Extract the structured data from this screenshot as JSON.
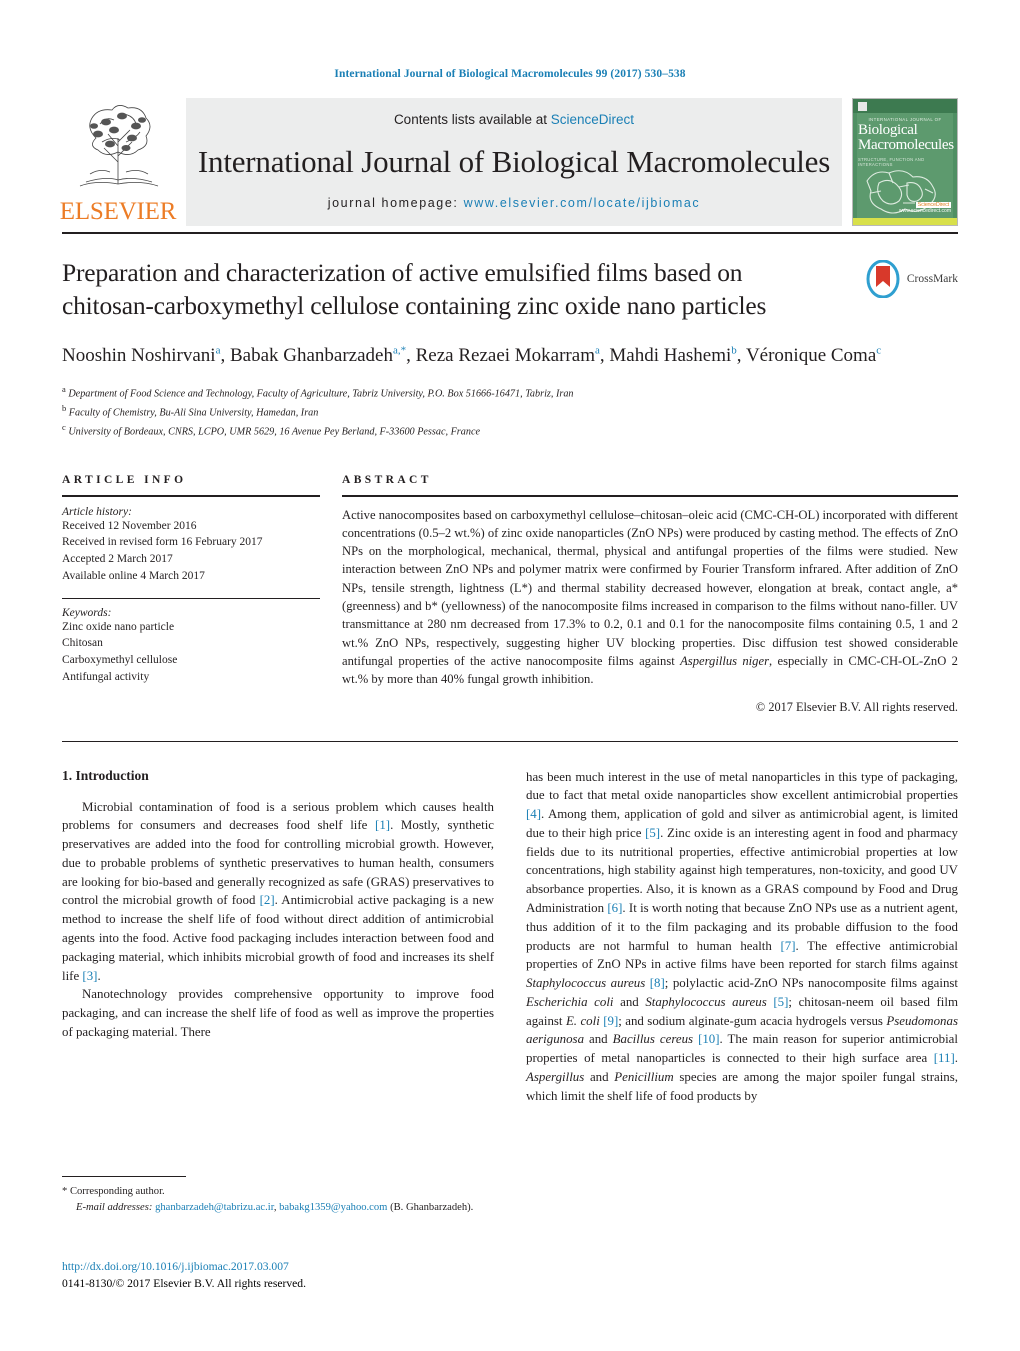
{
  "running_head": "International Journal of Biological Macromolecules 99 (2017) 530–538",
  "masthead": {
    "publisher": "ELSEVIER",
    "contents_prefix": "Contents lists available at ",
    "contents_link": "ScienceDirect",
    "journal_title": "International Journal of Biological Macromolecules",
    "homepage_prefix": "journal homepage: ",
    "homepage_url": "www.elsevier.com/locate/ijbiomac",
    "cover": {
      "kicker": "INTERNATIONAL JOURNAL OF",
      "line1": "Biological",
      "line2": "Macromolecules",
      "subtitle": "STRUCTURE, FUNCTION AND INTERACTIONS",
      "sciencedirect": "ScienceDirect",
      "sciencedirect_sub": "www.sciencedirect.com"
    }
  },
  "article": {
    "title": "Preparation and characterization of active emulsified films based on chitosan-carboxymethyl cellulose containing zinc oxide nano particles",
    "crossmark_label": "CrossMark",
    "authors_html": "Nooshin Noshirvani<sup>a</sup>, Babak Ghanbarzadeh<sup>a,*</sup>, Reza Rezaei Mokarram<sup>a</sup>, Mahdi Hashemi<sup>b</sup>, Véronique Coma<sup>c</sup>",
    "affiliations": [
      {
        "marker": "a",
        "text": "Department of Food Science and Technology, Faculty of Agriculture, Tabriz University, P.O. Box 51666-16471, Tabriz, Iran"
      },
      {
        "marker": "b",
        "text": "Faculty of Chemistry, Bu-Ali Sina University, Hamedan, Iran"
      },
      {
        "marker": "c",
        "text": "University of Bordeaux, CNRS, LCPO, UMR 5629, 16 Avenue Pey Berland, F-33600 Pessac, France"
      }
    ]
  },
  "article_info": {
    "label": "ARTICLE INFO",
    "history_heading": "Article history:",
    "history": [
      "Received 12 November 2016",
      "Received in revised form 16 February 2017",
      "Accepted 2 March 2017",
      "Available online 4 March 2017"
    ],
    "keywords_heading": "Keywords:",
    "keywords": [
      "Zinc oxide nano particle",
      "Chitosan",
      "Carboxymethyl cellulose",
      "Antifungal activity"
    ]
  },
  "abstract": {
    "label": "ABSTRACT",
    "text_html": "Active nanocomposites based on carboxymethyl cellulose–chitosan–oleic acid (CMC-CH-OL) incorporated with different concentrations (0.5–2 wt.%) of zinc oxide nanoparticles (ZnO NPs) were produced by casting method. The effects of ZnO NPs on the morphological, mechanical, thermal, physical and antifungal properties of the films were studied. New interaction between ZnO NPs and polymer matrix were confirmed by Fourier Transform infrared. After addition of ZnO NPs, tensile strength, lightness (L*) and thermal stability decreased however, elongation at break, contact angle, a* (greenness) and b* (yellowness) of the nanocomposite films increased in comparison to the films without nano-filler. UV transmittance at 280 nm decreased from 17.3% to 0.2, 0.1 and 0.1 for the nanocomposite films containing 0.5, 1 and 2 wt.% ZnO NPs, respectively, suggesting higher UV blocking properties. Disc diffusion test showed considerable antifungal properties of the active nanocomposite films against <i>Aspergillus niger</i>, especially in CMC-CH-OL-ZnO 2 wt.% by more than 40% fungal growth inhibition.",
    "copyright": "© 2017 Elsevier B.V. All rights reserved."
  },
  "body": {
    "section_heading": "1. Introduction",
    "left_paragraphs_html": [
      "Microbial contamination of food is a serious problem which causes health problems for consumers and decreases food shelf life <span class=\"ref\">[1]</span>. Mostly, synthetic preservatives are added into the food for controlling microbial growth. However, due to probable problems of synthetic preservatives to human health, consumers are looking for bio-based and generally recognized as safe (GRAS) preservatives to control the microbial growth of food <span class=\"ref\">[2]</span>. Antimicrobial active packaging is a new method to increase the shelf life of food without direct addition of antimicrobial agents into the food. Active food packaging includes interaction between food and packaging material, which inhibits microbial growth of food and increases its shelf life <span class=\"ref\">[3]</span>.",
      "Nanotechnology provides comprehensive opportunity to improve food packaging, and can increase the shelf life of food as well as improve the properties of packaging material. There"
    ],
    "right_paragraphs_html": [
      "has been much interest in the use of metal nanoparticles in this type of packaging, due to fact that metal oxide nanoparticles show excellent antimicrobial properties <span class=\"ref\">[4]</span>. Among them, application of gold and silver as antimicrobial agent, is limited due to their high price <span class=\"ref\">[5]</span>. Zinc oxide is an interesting agent in food and pharmacy fields due to its nutritional properties, effective antimicrobial properties at low concentrations, high stability against high temperatures, non-toxicity, and good UV absorbance properties. Also, it is known as a GRAS compound by Food and Drug Administration <span class=\"ref\">[6]</span>. It is worth noting that because ZnO NPs use as a nutrient agent, thus addition of it to the film packaging and its probable diffusion to the food products are not harmful to human health <span class=\"ref\">[7]</span>. The effective antimicrobial properties of ZnO NPs in active films have been reported for starch films against <i>Staphylococcus aureus</i> <span class=\"ref\">[8]</span>; polylactic acid-ZnO NPs nanocomposite films against <i>Escherichia coli</i> and <i>Staphylococcus aureus</i> <span class=\"ref\">[5]</span>; chitosan-neem oil based film against <i>E. coli</i> <span class=\"ref\">[9]</span>; and sodium alginate-gum acacia hydrogels versus <i>Pseudomonas aerigunosa</i> and <i>Bacillus cereus</i> <span class=\"ref\">[10]</span>. The main reason for superior antimicrobial properties of metal nanoparticles is connected to their high surface area <span class=\"ref\">[11]</span>. <i>Aspergillus</i> and <i>Penicillium</i> species are among the major spoiler fungal strains, which limit the shelf life of food products by"
    ]
  },
  "footnote": {
    "corresponding": "* Corresponding author.",
    "email_label": "E-mail addresses:",
    "email1": "ghanbarzadeh@tabrizu.ac.ir",
    "email2": "babakg1359@yahoo.com",
    "email_suffix": "(B. Ghanbarzadeh)."
  },
  "footer": {
    "doi": "http://dx.doi.org/10.1016/j.ijbiomac.2017.03.007",
    "issn_line": "0141-8130/© 2017 Elsevier B.V. All rights reserved."
  },
  "colors": {
    "link_blue": "#1a7fb5",
    "elsevier_orange": "#ec7c26",
    "banner_grey": "#eceded",
    "cover_green": "#5d9a6e",
    "crossmark_blue": "#2f9fd0",
    "crossmark_red": "#d8392b"
  }
}
